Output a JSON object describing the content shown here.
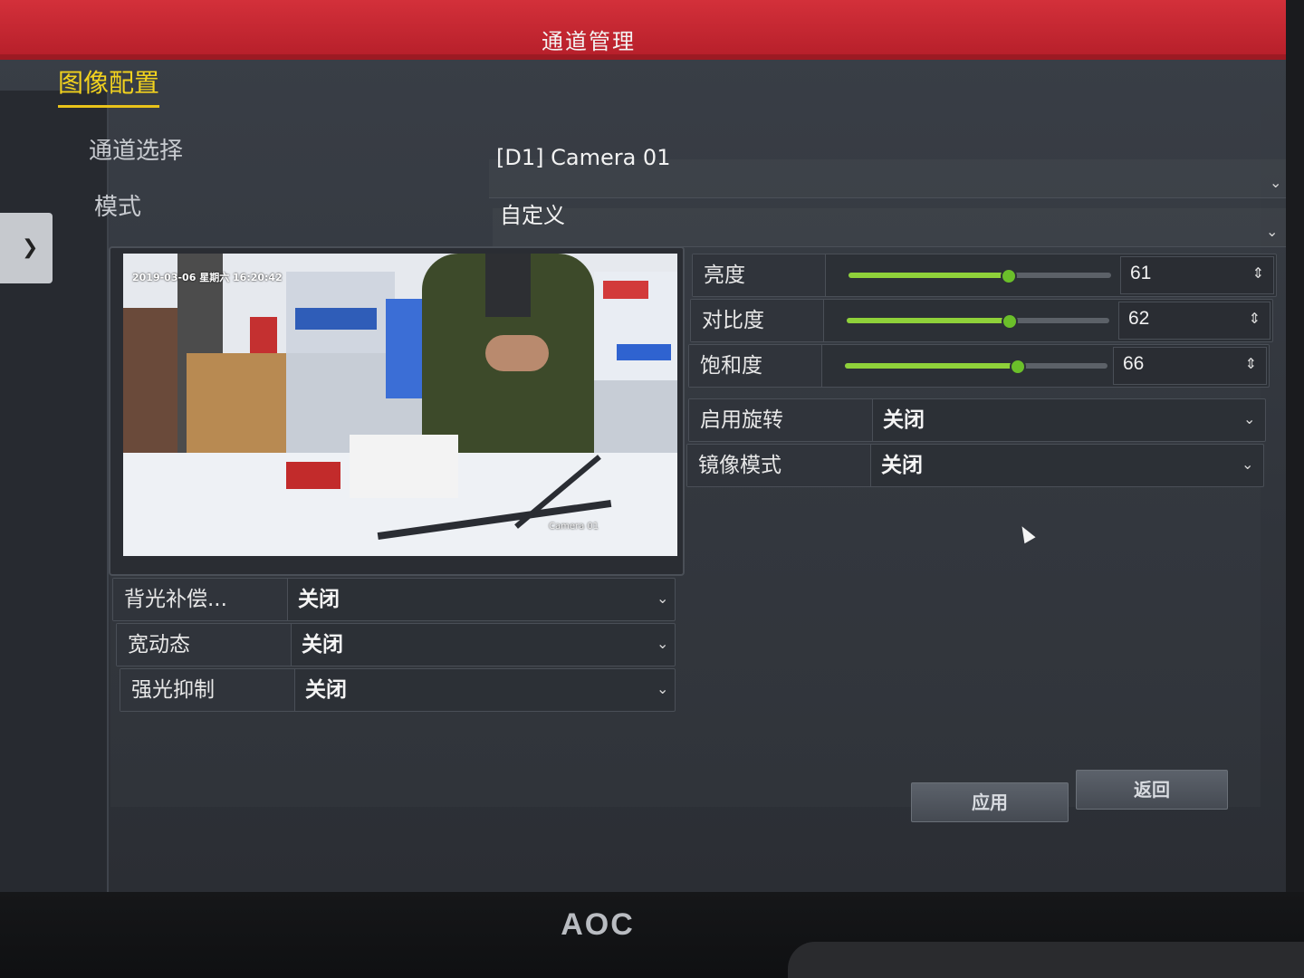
{
  "window": {
    "title": "通道管理"
  },
  "section_tab": "图像配置",
  "channel": {
    "label": "通道选择",
    "value": "[D1] Camera 01"
  },
  "mode": {
    "label": "模式",
    "value": "自定义"
  },
  "preview": {
    "osd_time": "2019-03-06 星期六 16:20:42",
    "osd_camera": "Camera 01"
  },
  "adjustments": [
    {
      "label": "亮度",
      "value": 61
    },
    {
      "label": "对比度",
      "value": 62
    },
    {
      "label": "饱和度",
      "value": 66
    }
  ],
  "right_options": [
    {
      "label": "启用旋转",
      "value": "关闭"
    },
    {
      "label": "镜像模式",
      "value": "关闭"
    }
  ],
  "left_options": [
    {
      "label": "背光补偿...",
      "value": "关闭"
    },
    {
      "label": "宽动态",
      "value": "关闭"
    },
    {
      "label": "强光抑制",
      "value": "关闭"
    }
  ],
  "buttons": {
    "apply": "应用",
    "back": "返回"
  },
  "monitor_brand": "AOC",
  "colors": {
    "titlebar": "#c8262f",
    "accent_tab": "#f2d21e",
    "slider": "#8fd13a"
  },
  "icons": {
    "dropdown": "chevron-down-icon",
    "spinner": "spinner-arrows-icon",
    "nav_expand": "chevron-right-icon",
    "cursor": "mouse-pointer-icon"
  }
}
